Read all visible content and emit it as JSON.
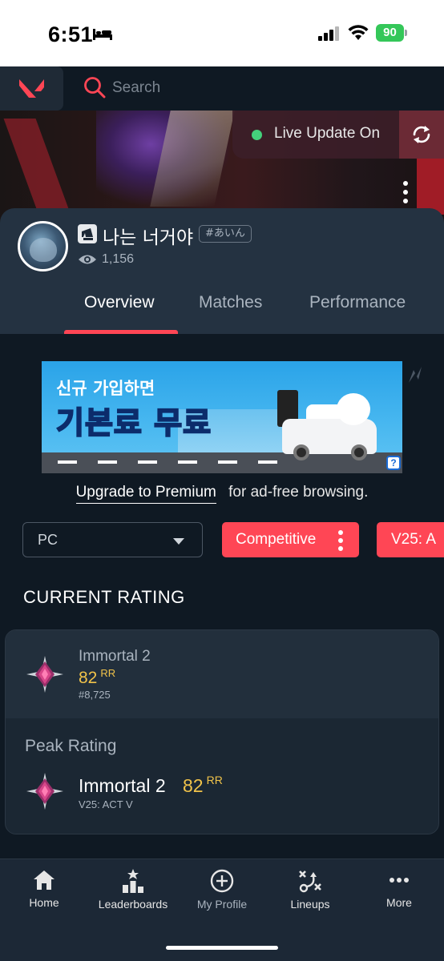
{
  "status_bar": {
    "time": "6:51",
    "battery": "90"
  },
  "header": {
    "search_placeholder": "Search",
    "live_update_label": "Live Update On"
  },
  "profile": {
    "name": "나는 너거야",
    "tag": "#あいん",
    "views": "1,156",
    "tabs": [
      {
        "label": "Overview",
        "active": true
      },
      {
        "label": "Matches",
        "active": false
      },
      {
        "label": "Performance",
        "active": false
      }
    ]
  },
  "ad": {
    "headline_small": "신규 가입하면",
    "headline_big": "기본료 무료",
    "help_label": "?"
  },
  "premium": {
    "link_label": "Upgrade to Premium",
    "suffix": "for ad-free browsing."
  },
  "filters": {
    "platform": "PC",
    "mode": "Competitive",
    "act": "V25: A"
  },
  "rating": {
    "section_title": "CURRENT RATING",
    "current": {
      "rank": "Immortal 2",
      "rr": "82",
      "rr_unit": "RR",
      "leaderboard": "#8,725"
    },
    "peak": {
      "title": "Peak Rating",
      "rank": "Immortal 2",
      "rr": "82",
      "rr_unit": "RR",
      "act": "V25: ACT V"
    }
  },
  "bottom_nav": [
    {
      "label": "Home",
      "icon": "home-icon"
    },
    {
      "label": "Leaderboards",
      "icon": "leaderboards-icon"
    },
    {
      "label": "My Profile",
      "icon": "add-circle-icon"
    },
    {
      "label": "Lineups",
      "icon": "lineups-icon"
    },
    {
      "label": "More",
      "icon": "more-icon"
    }
  ],
  "colors": {
    "accent": "#ff4655",
    "background": "#0f1923",
    "card": "#243241",
    "rr_gold": "#f1c34a",
    "live_green": "#44d07b"
  }
}
